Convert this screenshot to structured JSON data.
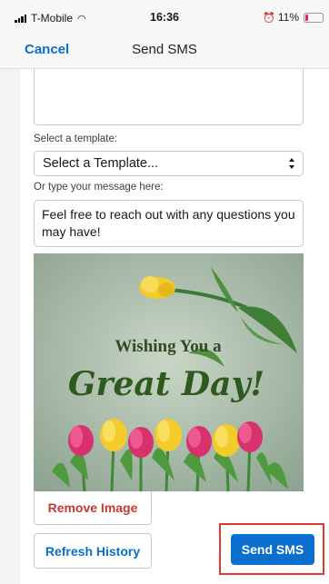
{
  "status_bar": {
    "carrier": "T-Mobile",
    "time": "16:36",
    "battery": "11%"
  },
  "nav": {
    "cancel_label": "Cancel",
    "title": "Send SMS"
  },
  "form": {
    "template_label": "Select a template:",
    "template_value": "Select a Template...",
    "message_label": "Or type your message here:",
    "message_value": "Feel free to reach out with any questions you may have!"
  },
  "image": {
    "line1": "Wishing You a",
    "line2": "Great Day!"
  },
  "buttons": {
    "remove_image": "Remove Image",
    "refresh_history": "Refresh History",
    "send_sms": "Send SMS"
  },
  "colors": {
    "brand_blue": "#0b6fd0",
    "remove_red": "#c23934",
    "highlight_red": "#e0382e",
    "tulip_yellow": "#f6d23a",
    "tulip_pink": "#d8326e"
  }
}
